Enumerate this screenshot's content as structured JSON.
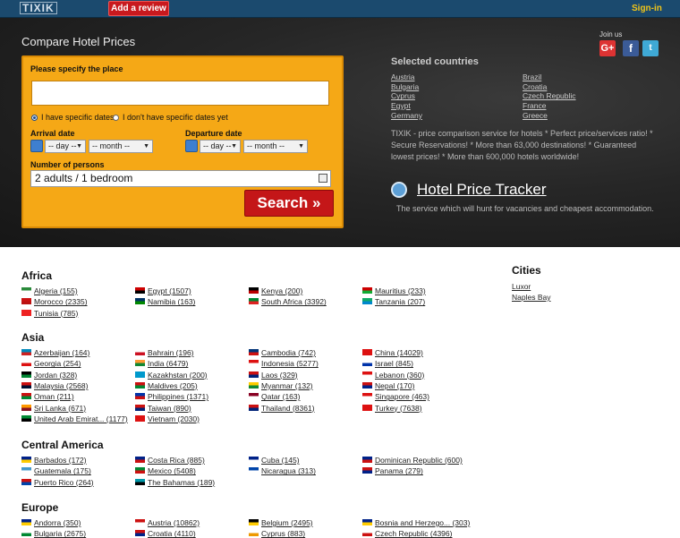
{
  "header": {
    "logo": "TIXIK",
    "review_button": "Add a review",
    "signin": "Sign-in"
  },
  "hero": {
    "title": "Compare Hotel Prices",
    "join_us": "Join us",
    "social": [
      "G+",
      "f",
      "t"
    ],
    "form": {
      "place_label": "Please specify the place",
      "place_value": "",
      "radio_specific": "I have specific dates",
      "radio_no_specific": "I don't have specific dates yet",
      "arrival_label": "Arrival date",
      "departure_label": "Departure date",
      "day_option": "-- day --",
      "month_option": "-- month --",
      "persons_label": "Number of persons",
      "persons_value": "2 adults / 1 bedroom",
      "search_button": "Search »"
    },
    "selected_title": "Selected countries",
    "selected_left": [
      "Austria",
      "Bulgaria",
      "Cyprus",
      "Egypt",
      "Germany"
    ],
    "selected_right": [
      "Brazil",
      "Croatia",
      "Czech Republic",
      "France",
      "Greece"
    ],
    "description": "TIXIK - price comparison service for hotels * Perfect price/services ratio! * Secure Reservations! * More than 63,000 destinations! * Guaranteed lowest prices! * More than 600,000 hotels worldwide!",
    "tracker_title": "Hotel Price Tracker",
    "tracker_sub": "The service which will hunt for vacancies and cheapest accommodation."
  },
  "regions": [
    {
      "name": "Africa",
      "countries": [
        {
          "label": "Algeria (155)",
          "colors": [
            "#2a8a3a",
            "#fff"
          ]
        },
        {
          "label": "Egypt (1507)",
          "colors": [
            "#c00",
            "#000"
          ]
        },
        {
          "label": "Kenya (200)",
          "colors": [
            "#000",
            "#b00"
          ]
        },
        {
          "label": "Mauritius (233)",
          "colors": [
            "#c00",
            "#1a3"
          ]
        },
        {
          "label": "Morocco (2335)",
          "colors": [
            "#c11",
            "#b11"
          ]
        },
        {
          "label": "Namibia (163)",
          "colors": [
            "#036",
            "#080"
          ]
        },
        {
          "label": "South Africa (3392)",
          "colors": [
            "#083",
            "#d22"
          ]
        },
        {
          "label": "Tanzania (207)",
          "colors": [
            "#1a6",
            "#08c"
          ]
        },
        {
          "label": "Tunisia (785)",
          "colors": [
            "#e22",
            "#e22"
          ]
        }
      ]
    },
    {
      "name": "Asia",
      "countries": [
        {
          "label": "Azerbaijan (164)",
          "colors": [
            "#08b",
            "#c22"
          ]
        },
        {
          "label": "Bahrain (196)",
          "colors": [
            "#fff",
            "#c12"
          ]
        },
        {
          "label": "Cambodia (742)",
          "colors": [
            "#037",
            "#c11"
          ]
        },
        {
          "label": "China (14029)",
          "colors": [
            "#d11",
            "#d11"
          ]
        },
        {
          "label": "Georgia (254)",
          "colors": [
            "#fff",
            "#d11"
          ]
        },
        {
          "label": "India (6479)",
          "colors": [
            "#f93",
            "#183"
          ]
        },
        {
          "label": "Indonesia (5277)",
          "colors": [
            "#d11",
            "#fff"
          ]
        },
        {
          "label": "Israel (845)",
          "colors": [
            "#fff",
            "#03a"
          ]
        },
        {
          "label": "Jordan (328)",
          "colors": [
            "#000",
            "#083"
          ]
        },
        {
          "label": "Kazakhstan (200)",
          "colors": [
            "#09c",
            "#09c"
          ]
        },
        {
          "label": "Laos (329)",
          "colors": [
            "#c11",
            "#027"
          ]
        },
        {
          "label": "Lebanon (360)",
          "colors": [
            "#d11",
            "#fff"
          ]
        },
        {
          "label": "Malaysia (2568)",
          "colors": [
            "#c11",
            "#013"
          ]
        },
        {
          "label": "Maldives (205)",
          "colors": [
            "#c11",
            "#083"
          ]
        },
        {
          "label": "Myanmar (132)",
          "colors": [
            "#fc0",
            "#183"
          ]
        },
        {
          "label": "Nepal (170)",
          "colors": [
            "#c11",
            "#028"
          ]
        },
        {
          "label": "Oman (211)",
          "colors": [
            "#c11",
            "#083"
          ]
        },
        {
          "label": "Philippines (1371)",
          "colors": [
            "#03a",
            "#c11"
          ]
        },
        {
          "label": "Qatar (163)",
          "colors": [
            "#802",
            "#fff"
          ]
        },
        {
          "label": "Singapore (463)",
          "colors": [
            "#d11",
            "#fff"
          ]
        },
        {
          "label": "Sri Lanka (671)",
          "colors": [
            "#f90",
            "#812"
          ]
        },
        {
          "label": "Taiwan (890)",
          "colors": [
            "#c11",
            "#027"
          ]
        },
        {
          "label": "Thailand (8361)",
          "colors": [
            "#c11",
            "#027"
          ]
        },
        {
          "label": "Turkey (7638)",
          "colors": [
            "#d11",
            "#d11"
          ]
        },
        {
          "label": "United Arab Emirat... (1177)",
          "colors": [
            "#083",
            "#000"
          ]
        },
        {
          "label": "Vietnam (2030)",
          "colors": [
            "#d11",
            "#d11"
          ]
        }
      ]
    },
    {
      "name": "Central America",
      "countries": [
        {
          "label": "Barbados (172)",
          "colors": [
            "#028",
            "#fc0"
          ]
        },
        {
          "label": "Costa Rica (885)",
          "colors": [
            "#028",
            "#c11"
          ]
        },
        {
          "label": "Cuba (145)",
          "colors": [
            "#028",
            "#fff"
          ]
        },
        {
          "label": "Dominican Republic (600)",
          "colors": [
            "#028",
            "#c11"
          ]
        },
        {
          "label": "Guatemala (175)",
          "colors": [
            "#49c",
            "#fff"
          ]
        },
        {
          "label": "Mexico (5408)",
          "colors": [
            "#083",
            "#c11"
          ]
        },
        {
          "label": "Nicaragua (313)",
          "colors": [
            "#04a",
            "#fff"
          ]
        },
        {
          "label": "Panama (279)",
          "colors": [
            "#c11",
            "#028"
          ]
        },
        {
          "label": "Puerto Rico (264)",
          "colors": [
            "#c11",
            "#04a"
          ]
        },
        {
          "label": "The Bahamas (189)",
          "colors": [
            "#09a",
            "#000"
          ]
        }
      ]
    },
    {
      "name": "Europe",
      "countries": [
        {
          "label": "Andorra (350)",
          "colors": [
            "#028",
            "#fc0"
          ]
        },
        {
          "label": "Austria (10862)",
          "colors": [
            "#c11",
            "#fff"
          ]
        },
        {
          "label": "Belgium (2495)",
          "colors": [
            "#000",
            "#fc0"
          ]
        },
        {
          "label": "Bosnia and Herzego... (303)",
          "colors": [
            "#028",
            "#fc0"
          ]
        },
        {
          "label": "Bulgaria (2675)",
          "colors": [
            "#fff",
            "#083"
          ]
        },
        {
          "label": "Croatia (4110)",
          "colors": [
            "#c11",
            "#028"
          ]
        },
        {
          "label": "Cyprus (883)",
          "colors": [
            "#fff",
            "#e90"
          ]
        },
        {
          "label": "Czech Republic (4396)",
          "colors": [
            "#fff",
            "#c11"
          ]
        }
      ]
    }
  ],
  "cities": {
    "title": "Cities",
    "items": [
      "Luxor",
      "Naples Bay"
    ]
  }
}
